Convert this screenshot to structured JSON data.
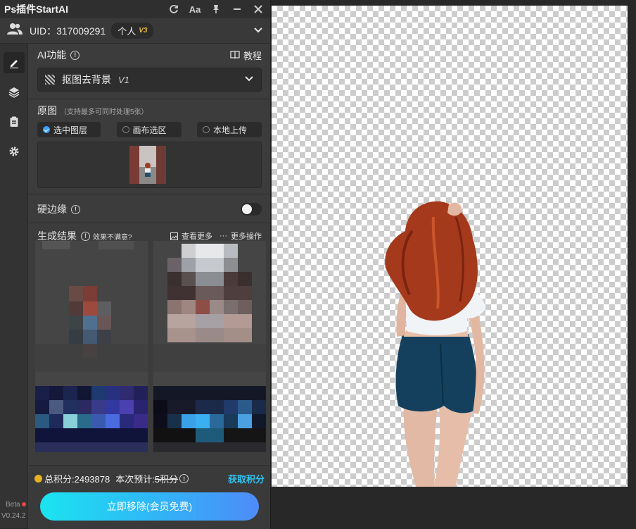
{
  "titlebar": {
    "title": "Ps插件StartAI",
    "font_button": "Aa"
  },
  "user": {
    "uid": "UID：317009291",
    "tier_label": "个人",
    "tier_badge": "V3"
  },
  "ai_feature": {
    "label": "AI功能",
    "tutorial": "教程",
    "selected_name": "抠图去背景",
    "selected_version": "V1"
  },
  "source": {
    "label": "原图",
    "note": "（支持最多可同时处理5张）",
    "options": [
      "选中图层",
      "画布选区",
      "本地上传"
    ],
    "selected_option": "选中图层"
  },
  "hard_edge": {
    "label": "硬边缘",
    "enabled": false
  },
  "results": {
    "label": "生成结果",
    "feedback": "效果不满意?",
    "view_more": "查看更多",
    "more_actions": "更多操作"
  },
  "footer": {
    "total_points": "总积分:2493878",
    "estimate_label": "本次预计:",
    "estimate_value": "5积分",
    "get_points": "获取积分",
    "cta": "立即移除(会员免费)"
  },
  "sidebar": {
    "items": [
      "edit-icon",
      "layers-icon",
      "clipboard-icon",
      "gear-icon"
    ],
    "beta": "Beta",
    "version": "V0.24.2"
  },
  "colors": {
    "accent_blue": "#2fc4f0",
    "cta_gradient_start": "#1be4f0",
    "cta_gradient_end": "#4e8bf9",
    "tier_badge": "#e8b940",
    "checked_radio": "#3aa0ff"
  }
}
